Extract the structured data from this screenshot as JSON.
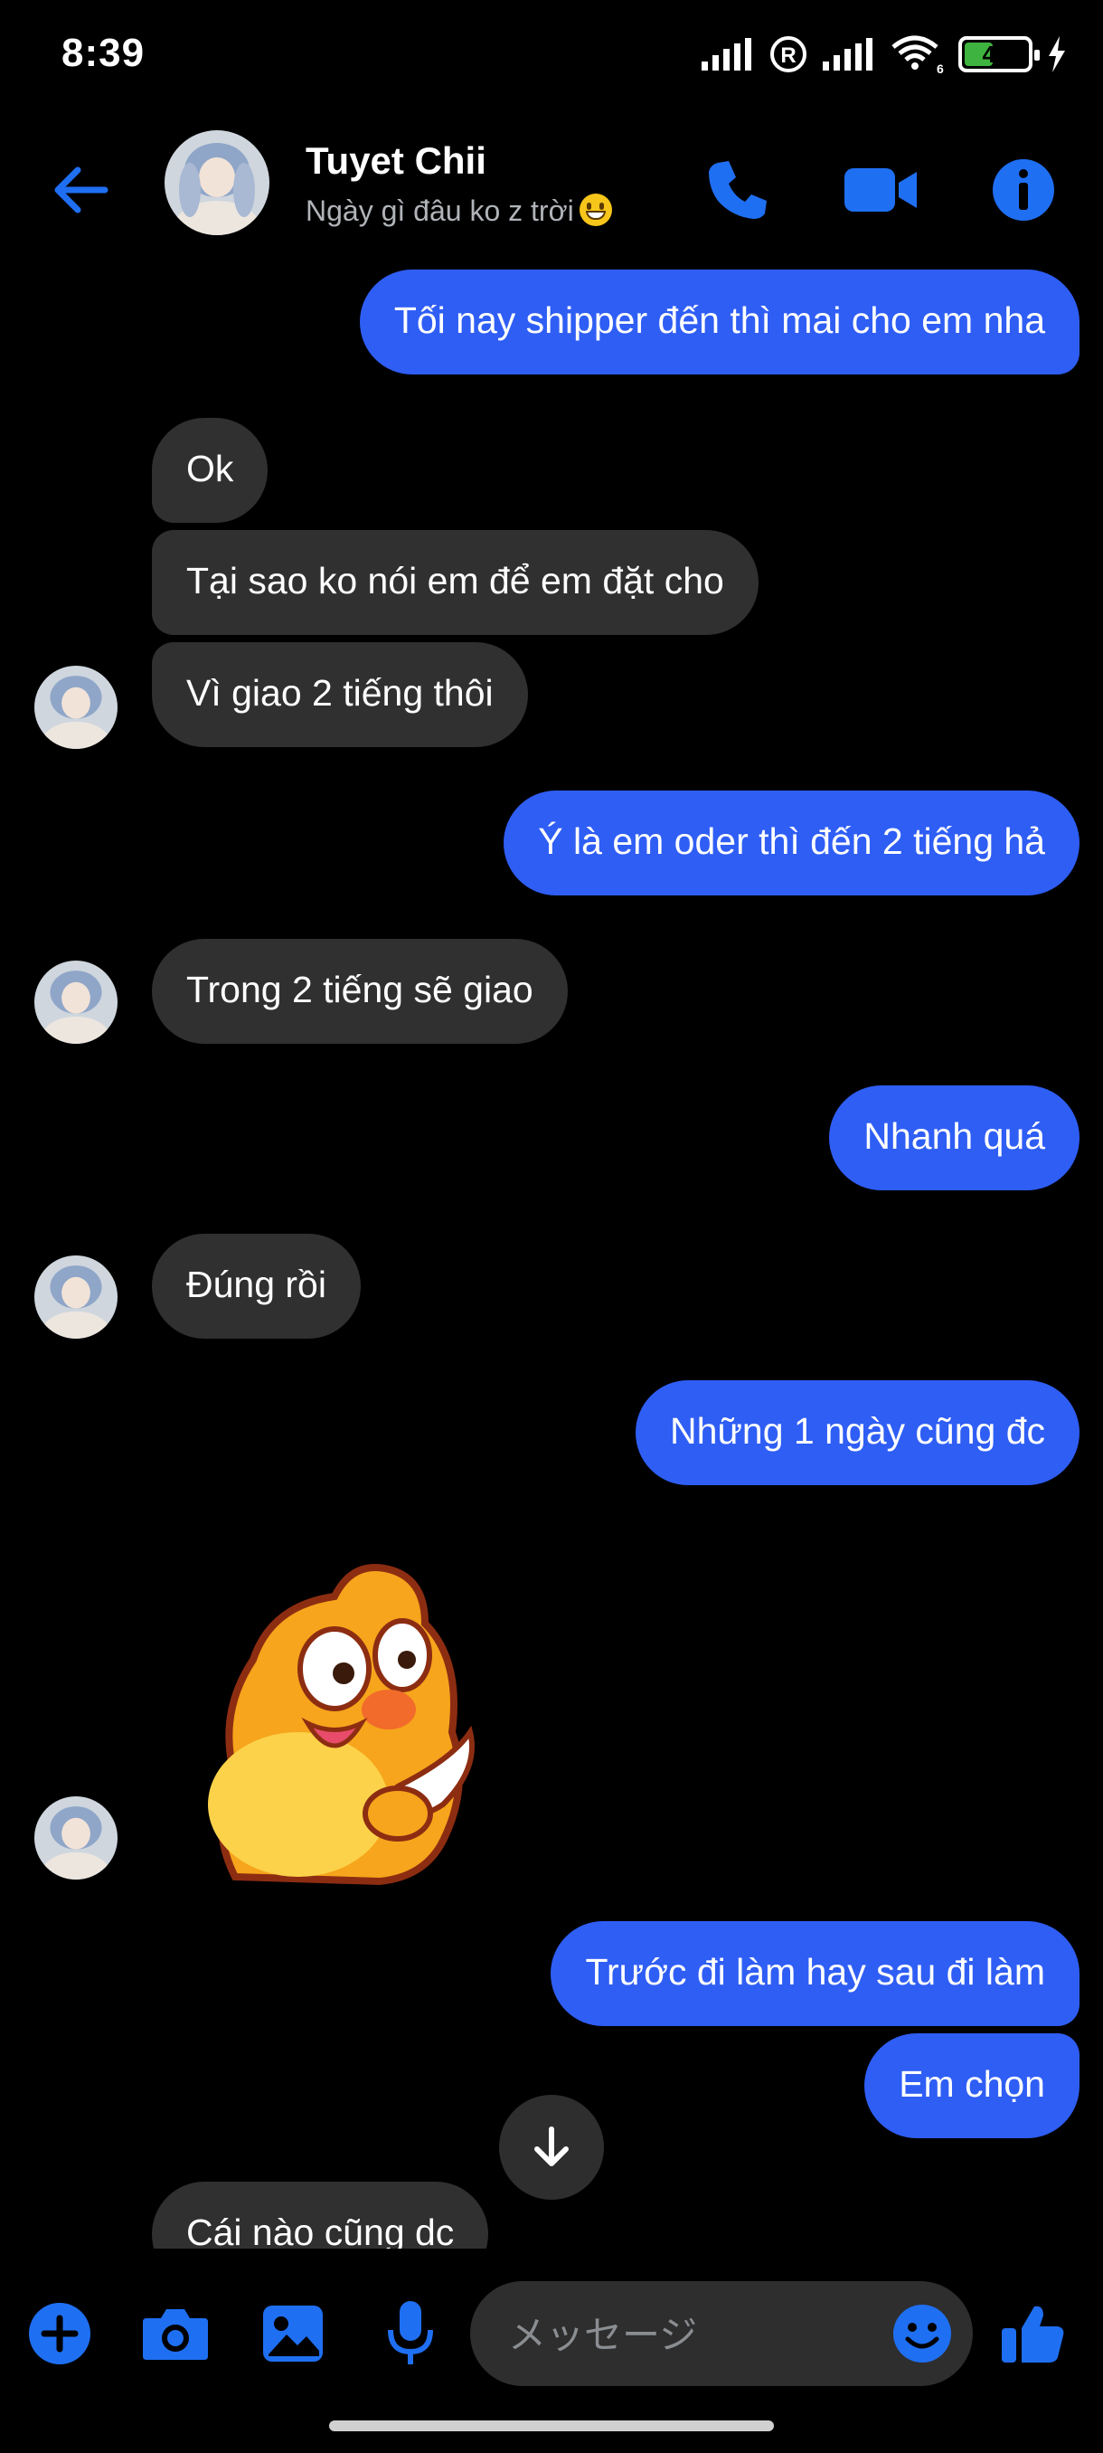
{
  "status_bar": {
    "time": "8:39",
    "battery": "45",
    "battery_level": 0.45
  },
  "header": {
    "name": "Tuyet Chii",
    "status": "Ngày gì đâu ko z trời"
  },
  "messages": [
    {
      "from": "me",
      "text": "Tối nay shipper đến thì mai cho em nha"
    },
    {
      "from": "them",
      "text": "Ok"
    },
    {
      "from": "them",
      "text": "Tại sao ko nói em để em đặt cho"
    },
    {
      "from": "them",
      "text": "Vì giao 2 tiếng thôi"
    },
    {
      "from": "me",
      "text": "Ý là em oder thì đến 2 tiếng hả"
    },
    {
      "from": "them",
      "text": "Trong 2 tiếng sẽ giao"
    },
    {
      "from": "me",
      "text": "Nhanh quá"
    },
    {
      "from": "them",
      "text": "Đúng rồi"
    },
    {
      "from": "me",
      "text": "Những 1 ngày cũng đc"
    },
    {
      "from": "them",
      "type": "sticker",
      "sticker": "qoobee-thumbs-up"
    },
    {
      "from": "me",
      "text": "Trước đi làm hay sau đi làm"
    },
    {
      "from": "me",
      "text": "Em chọn"
    },
    {
      "from": "them",
      "text": "Cái nào cũng dc"
    }
  ],
  "composer": {
    "placeholder": "メッセージ"
  },
  "icons": {
    "back": "arrow-left-icon",
    "call": "phone-icon",
    "video": "video-camera-icon",
    "info": "info-icon",
    "add": "plus-icon",
    "camera": "camera-icon",
    "gallery": "image-icon",
    "mic": "microphone-icon",
    "emoji": "smiley-icon",
    "like": "thumbs-up-icon",
    "scroll": "arrow-down-icon"
  },
  "colors": {
    "accent": "#2f5ef5",
    "icon_blue": "#1f6ff2",
    "incoming": "#303030",
    "background": "#000000"
  }
}
